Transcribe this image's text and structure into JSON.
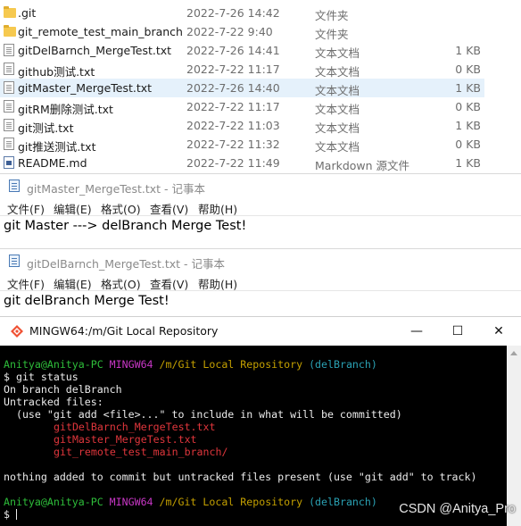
{
  "explorer": {
    "rows": [
      {
        "name": ".git",
        "date": "2022-7-26 14:42",
        "type": "文件夹",
        "size": "",
        "icon": "folder-icon"
      },
      {
        "name": "git_remote_test_main_branch",
        "date": "2022-7-22 9:40",
        "type": "文件夹",
        "size": "",
        "icon": "folder-icon"
      },
      {
        "name": "gitDelBarnch_MergeTest.txt",
        "date": "2022-7-26 14:41",
        "type": "文本文档",
        "size": "1 KB",
        "icon": "text-file-icon"
      },
      {
        "name": "github测试.txt",
        "date": "2022-7-22 11:17",
        "type": "文本文档",
        "size": "0 KB",
        "icon": "text-file-icon"
      },
      {
        "name": "gitMaster_MergeTest.txt",
        "date": "2022-7-26 14:40",
        "type": "文本文档",
        "size": "1 KB",
        "icon": "text-file-icon",
        "selected": true
      },
      {
        "name": "gitRM删除测试.txt",
        "date": "2022-7-22 11:17",
        "type": "文本文档",
        "size": "0 KB",
        "icon": "text-file-icon"
      },
      {
        "name": "git测试.txt",
        "date": "2022-7-22 11:03",
        "type": "文本文档",
        "size": "1 KB",
        "icon": "text-file-icon"
      },
      {
        "name": "git推送测试.txt",
        "date": "2022-7-22 11:32",
        "type": "文本文档",
        "size": "0 KB",
        "icon": "text-file-icon"
      },
      {
        "name": "README.md",
        "date": "2022-7-22 11:49",
        "type": "Markdown 源文件",
        "size": "1 KB",
        "icon": "markdown-file-icon"
      }
    ],
    "selected_color": "#e5f1fb"
  },
  "notepad1": {
    "title": "gitMaster_MergeTest.txt - 记事本",
    "menu": [
      "文件(F)",
      "编辑(E)",
      "格式(O)",
      "查看(V)",
      "帮助(H)"
    ],
    "content": "git Master ---> delBranch Merge Test!"
  },
  "notepad2": {
    "title": "gitDelBarnch_MergeTest.txt - 记事本",
    "menu": [
      "文件(F)",
      "编辑(E)",
      "格式(O)",
      "查看(V)",
      "帮助(H)"
    ],
    "content": "git delBranch Merge Test!"
  },
  "terminal": {
    "title": "MINGW64:/m/Git Local Repository",
    "buttons": {
      "minimize": "—",
      "maximize": "☐",
      "close": "✕"
    },
    "prompt_user": "Anitya@Anitya-PC",
    "prompt_env": "MINGW64",
    "prompt_path": "/m/Git Local Repository",
    "prompt_branch": "(delBranch)",
    "command": "$ git status",
    "output": [
      "On branch delBranch",
      "Untracked files:",
      "  (use \"git add <file>...\" to include in what will be committed)"
    ],
    "untracked": [
      "gitDelBarnch_MergeTest.txt",
      "gitMaster_MergeTest.txt",
      "git_remote_test_main_branch/"
    ],
    "summary": "nothing added to commit but untracked files present (use \"git add\" to track)",
    "prompt_symbol": "$",
    "colors": {
      "user": "#2ebd3a",
      "env": "#c837c6",
      "path": "#c4a000",
      "branch": "#2aa1b3",
      "untracked": "#e0363c"
    }
  },
  "watermark": "CSDN @Anitya_Pro"
}
